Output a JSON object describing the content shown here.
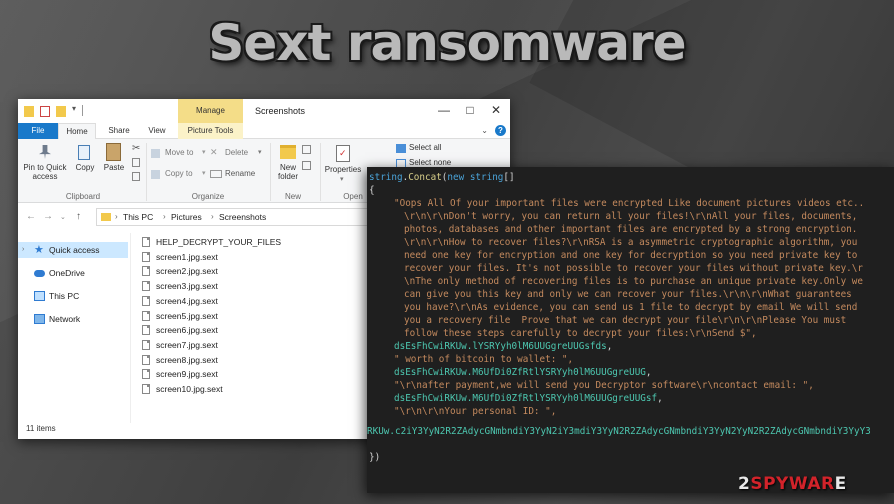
{
  "page": {
    "title": "Sext ransomware"
  },
  "explorer": {
    "window_title": "Screenshots",
    "manage_label": "Manage",
    "tabs": {
      "file": "File",
      "home": "Home",
      "share": "Share",
      "view": "View",
      "picture_tools": "Picture Tools"
    },
    "ribbon": {
      "pin_label": "Pin to Quick access",
      "copy_label": "Copy",
      "paste_label": "Paste",
      "move_to_label": "Move to",
      "copy_to_label": "Copy to",
      "delete_label": "Delete",
      "rename_label": "Rename",
      "new_folder_label": "New folder",
      "properties_label": "Properties",
      "select_all_label": "Select all",
      "select_none_label": "Select none",
      "groups": {
        "clipboard": "Clipboard",
        "organize": "Organize",
        "new": "New",
        "open": "Open"
      }
    },
    "breadcrumb": [
      "This PC",
      "Pictures",
      "Screenshots"
    ],
    "nav_items": [
      "Quick access",
      "OneDrive",
      "This PC",
      "Network"
    ],
    "files": [
      "HELP_DECRYPT_YOUR_FILES",
      "screen1.jpg.sext",
      "screen2.jpg.sext",
      "screen3.jpg.sext",
      "screen4.jpg.sext",
      "screen5.jpg.sext",
      "screen6.jpg.sext",
      "screen7.jpg.sext",
      "screen8.jpg.sext",
      "screen9.jpg.sext",
      "screen10.jpg.sext"
    ],
    "status": "11 items"
  },
  "code": {
    "l1_kw": "string",
    "l1_meth": "Concat",
    "l1_rest1": "(",
    "l1_new": "new",
    "l1_sp": " ",
    "l1_str": "string",
    "l1_rest2": "[]",
    "l2": "{",
    "s1": "\"Oops All Of your important files were encrypted Like document pictures videos etc..",
    "s2": "\\r\\n\\r\\nDon't worry, you can return all your files!\\r\\nAll your files, documents,",
    "s3": "photos, databases and other important files are encrypted by a strong encryption.",
    "s4": "\\r\\n\\r\\nHow to recover files?\\r\\nRSA is a asymmetric cryptographic algorithm, you",
    "s5": "need one key for encryption and one key for decryption so you need private key to",
    "s6": "recover your files. It's not possible to recover your files without private key.\\r",
    "s7": "\\nThe only method of recovering files is to purchase an unique private key.Only we",
    "s8": "can give you this key and only we can recover your files.\\r\\n\\r\\nWhat guarantees",
    "s9": "you have?\\r\\nAs evidence, you can send us 1 file to decrypt by email We will send",
    "s10": "you a recovery file  Prove that we can decrypt your file\\r\\n\\r\\nPlease You must",
    "s11": "follow these steps carefully to decrypt your files:\\r\\nSend $\",",
    "v1a": "dsEsFhCwiRKUw.",
    "v1b": "lYSRYyh0lM6UUGgreUUGsfds",
    "v1c": ",",
    "s12": "\" worth of bitcoin to wallet: \",",
    "v2a": "dsEsFhCwiRKUw.",
    "v2b": "M6UfDi0ZfRtlYSRYyh0lM6UUGgreUUG",
    "v2c": ",",
    "s13": "\"\\r\\nafter payment,we will send you Decryptor software\\r\\ncontact email: \",",
    "v3a": "dsEsFhCwiRKUw.",
    "v3b": "M6UfDi0ZfRtlYSRYyh0lM6UUGgreUUGsf",
    "v3c": ",",
    "s14": "\"\\r\\n\\r\\nYour personal ID: \",",
    "v4a": "RKUw.",
    "v4b": "c2iY3YyN2R2ZAdycGNmbndiY3YyN2iY3mdiY3YyN2R2ZAdycGNmbndiY3YyN2YyN2R2ZAdycGNmbndiY3YyY3",
    "end": "})"
  },
  "watermark": {
    "prefix": "2",
    "red": "SPYWAR",
    "suffix": "E"
  }
}
